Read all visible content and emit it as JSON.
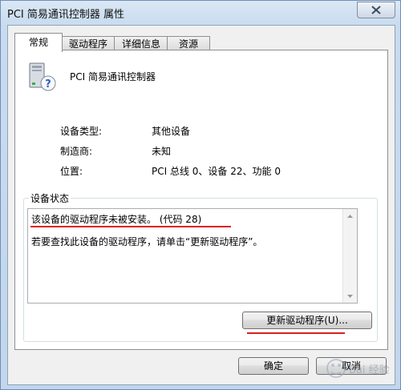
{
  "window": {
    "title": "PCI 简易通讯控制器 属性",
    "close_label": "close"
  },
  "tabs": [
    {
      "label": "常规",
      "active": true
    },
    {
      "label": "驱动程序",
      "active": false
    },
    {
      "label": "详细信息",
      "active": false
    },
    {
      "label": "资源",
      "active": false
    }
  ],
  "device": {
    "name": "PCI 简易通讯控制器",
    "icon": "unknown-device-icon",
    "properties": [
      {
        "label": "设备类型:",
        "value": "其他设备"
      },
      {
        "label": "制造商:",
        "value": "未知"
      },
      {
        "label": "位置:",
        "value": "PCI 总线 0、设备 22、功能 0"
      }
    ]
  },
  "status": {
    "group_label": "设备状态",
    "lines": [
      "该设备的驱动程序未被安装。 (代码 28)",
      "若要查找此设备的驱动程序，请单击“更新驱动程序”。"
    ]
  },
  "buttons": {
    "update_driver": "更新驱动程序(U)...",
    "ok": "确定",
    "cancel": "取消"
  },
  "annotation_color": "#e11b1b",
  "watermark_text": "Bai 经验"
}
